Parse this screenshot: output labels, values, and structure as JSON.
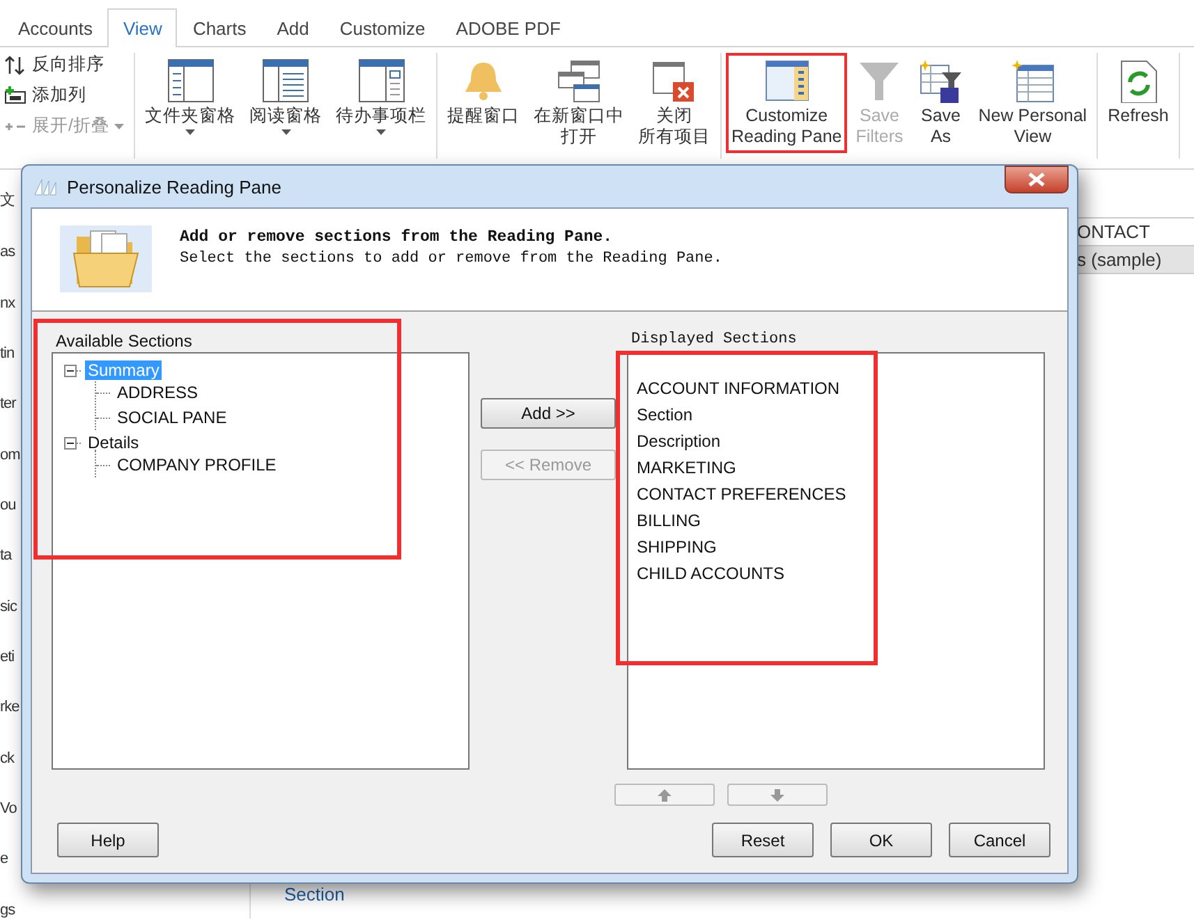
{
  "tabs": [
    {
      "label": "Accounts",
      "selected": false
    },
    {
      "label": "View",
      "selected": true
    },
    {
      "label": "Charts",
      "selected": false
    },
    {
      "label": "Add",
      "selected": false
    },
    {
      "label": "Customize",
      "selected": false
    },
    {
      "label": "ADOBE PDF",
      "selected": false
    }
  ],
  "ribbon": {
    "groups": [
      {
        "kind": "small",
        "items": [
          {
            "label": "反向排序",
            "disabled": false,
            "dropdown": false
          },
          {
            "label": "添加列",
            "disabled": false,
            "dropdown": false
          },
          {
            "label": "展开/折叠",
            "disabled": true,
            "dropdown": true
          }
        ]
      },
      {
        "kind": "large",
        "items": [
          {
            "lines": [
              "文件夹窗格"
            ],
            "disabled": false,
            "dropdown": true,
            "highlighted": false
          },
          {
            "lines": [
              "阅读窗格"
            ],
            "disabled": false,
            "dropdown": true,
            "highlighted": false
          },
          {
            "lines": [
              "待办事项栏"
            ],
            "disabled": false,
            "dropdown": true,
            "highlighted": false
          }
        ]
      },
      {
        "kind": "large",
        "items": [
          {
            "lines": [
              "提醒窗口"
            ],
            "disabled": false,
            "dropdown": false,
            "highlighted": false
          },
          {
            "lines": [
              "在新窗口中",
              "打开"
            ],
            "disabled": false,
            "dropdown": false,
            "highlighted": false
          },
          {
            "lines": [
              "关闭",
              "所有项目"
            ],
            "disabled": false,
            "dropdown": false,
            "highlighted": false
          }
        ]
      },
      {
        "kind": "large",
        "items": [
          {
            "lines": [
              "Customize",
              "Reading Pane"
            ],
            "disabled": false,
            "dropdown": false,
            "highlighted": true
          },
          {
            "lines": [
              "Save",
              "Filters"
            ],
            "disabled": true,
            "dropdown": false,
            "highlighted": false
          },
          {
            "lines": [
              "Save",
              "As"
            ],
            "disabled": false,
            "dropdown": false,
            "highlighted": false
          },
          {
            "lines": [
              "New Personal",
              "View"
            ],
            "disabled": false,
            "dropdown": false,
            "highlighted": false
          }
        ]
      },
      {
        "kind": "large",
        "items": [
          {
            "lines": [
              "Refresh"
            ],
            "disabled": false,
            "dropdown": false,
            "highlighted": false
          }
        ]
      }
    ]
  },
  "sidebar": {
    "items": [
      "文",
      "as",
      "nx",
      "tin",
      "ter",
      "om",
      "ou",
      "ta",
      "sic",
      "eti",
      "rke",
      "ck",
      "Vo",
      "e",
      "gs"
    ]
  },
  "list_rows": [
    {
      "text": "ONTACT",
      "selected": false
    },
    {
      "text": "s (sample)",
      "selected": true
    }
  ],
  "footer_link": "Section",
  "dialog": {
    "title": "Personalize Reading Pane",
    "heading": "Add or remove sections from the Reading Pane.",
    "instruction": "Select the sections to add or remove from the Reading Pane.",
    "available": {
      "label": "Available Sections",
      "highlighted": true,
      "tree": [
        {
          "text": "Summary",
          "selected": true,
          "expanded": true,
          "children": [
            {
              "text": "ADDRESS",
              "selected": false
            },
            {
              "text": "SOCIAL PANE",
              "selected": false
            }
          ]
        },
        {
          "text": "Details",
          "selected": false,
          "expanded": true,
          "children": [
            {
              "text": "COMPANY PROFILE",
              "selected": false
            }
          ]
        }
      ]
    },
    "add_button": {
      "label": "Add >>",
      "disabled": false
    },
    "remove_button": {
      "label": "<< Remove",
      "disabled": true
    },
    "displayed": {
      "label": "Displayed Sections",
      "highlighted": true,
      "items": [
        "ACCOUNT INFORMATION",
        "Section",
        "Description",
        "MARKETING",
        "CONTACT PREFERENCES",
        "BILLING",
        "SHIPPING",
        "CHILD ACCOUNTS"
      ]
    },
    "move_up": {
      "disabled": true
    },
    "move_down": {
      "disabled": true
    },
    "buttons": [
      {
        "label": "Help",
        "kind": "help"
      },
      {
        "label": "Reset",
        "kind": "action"
      },
      {
        "label": "OK",
        "kind": "action"
      },
      {
        "label": "Cancel",
        "kind": "action"
      }
    ]
  }
}
